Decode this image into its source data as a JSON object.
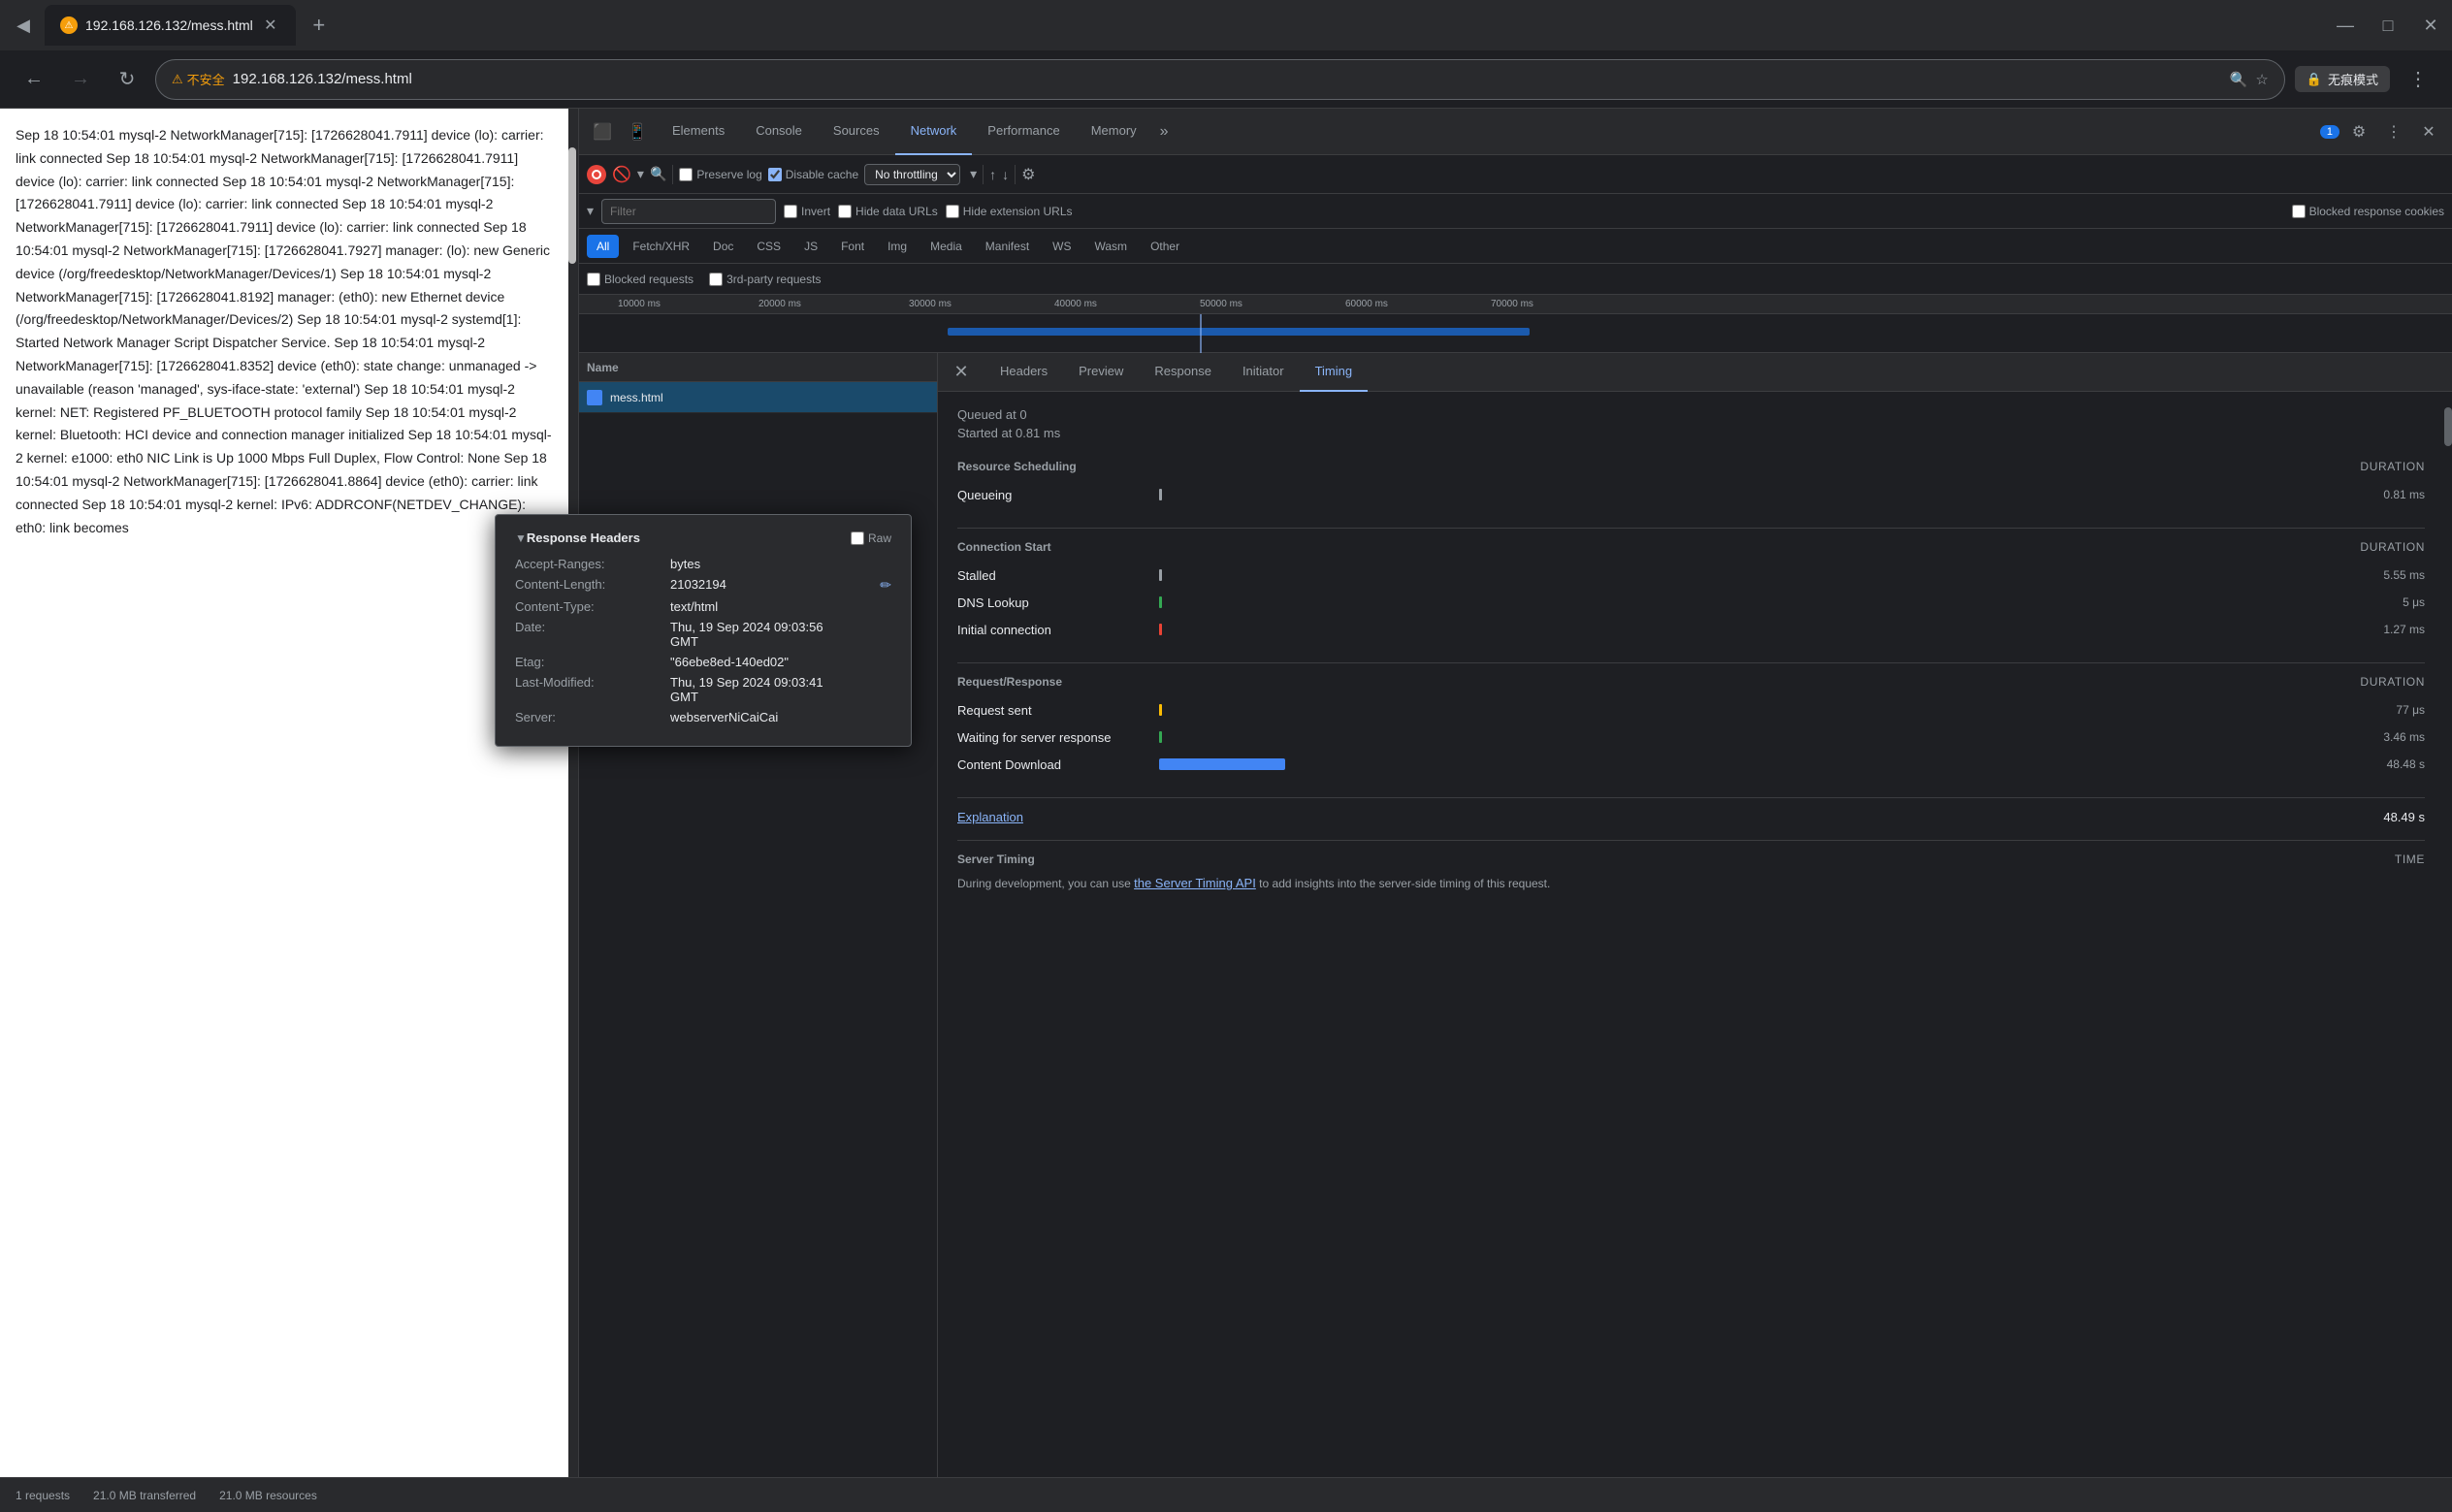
{
  "browser": {
    "tab_url": "192.168.126.132/mess.html",
    "tab_label": "192.168.126.132/mess.html",
    "new_tab_symbol": "+",
    "back_disabled": false,
    "forward_disabled": false,
    "security_warning": "不安全",
    "address": "192.168.126.132/mess.html",
    "private_mode_label": "无痕模式",
    "window_min": "—",
    "window_max": "□",
    "window_close": "✕"
  },
  "page_text": "Sep 18 10:54:01 mysql-2 NetworkManager[715]: [1726628041.7911] device (lo): carrier: link connected Sep 18 10:54:01 mysql-2 NetworkManager[715]: [1726628041.7911] device (lo): carrier: link connected Sep 18 10:54:01 mysql-2 NetworkManager[715]: [1726628041.7911] device (lo): carrier: link connected Sep 18 10:54:01 mysql-2 NetworkManager[715]: [1726628041.7911] device (lo): carrier: link connected Sep 18 10:54:01 mysql-2 NetworkManager[715]: [1726628041.7927] manager: (lo): new Generic device (/org/freedesktop/NetworkManager/Devices/1) Sep 18 10:54:01 mysql-2 NetworkManager[715]: [1726628041.8192] manager: (eth0): new Ethernet device (/org/freedesktop/NetworkManager/Devices/2) Sep 18 10:54:01 mysql-2 systemd[1]: Started Network Manager Script Dispatcher Service. Sep 18 10:54:01 mysql-2 NetworkManager[715]: [1726628041.8352] device (eth0): state change: unmanaged -> unavailable (reason 'managed', sys-iface-state: 'external') Sep 18 10:54:01 mysql-2 kernel: NET: Registered PF_BLUETOOTH protocol family Sep 18 10:54:01 mysql-2 kernel: Bluetooth: HCI device and connection manager initialized Sep 18 10:54:01 mysql-2 kernel: e1000: eth0 NIC Link is Up 1000 Mbps Full Duplex, Flow Control: None Sep 18 10:54:01 mysql-2 NetworkManager[715]: [1726628041.8864] device (eth0): carrier: link connected Sep 18 10:54:01 mysql-2 kernel: IPv6: ADDRCONF(NETDEV_CHANGE): eth0: link becomes",
  "devtools": {
    "tabs": [
      "Elements",
      "Console",
      "Sources",
      "Network",
      "Performance",
      "Memory",
      "»"
    ],
    "active_tab": "Network",
    "badge_count": "1",
    "controls": {
      "preserve_log": "Preserve log",
      "disable_cache": "Disable cache",
      "throttle": "No throttling"
    },
    "filter": {
      "placeholder": "Filter",
      "invert": "Invert",
      "hide_data_urls": "Hide data URLs",
      "hide_extension_urls": "Hide extension URLs",
      "blocked_cookies": "Blocked response cookies"
    },
    "filter_types": [
      "All",
      "Fetch/XHR",
      "Doc",
      "CSS",
      "JS",
      "Font",
      "Img",
      "Media",
      "Manifest",
      "WS",
      "Wasm",
      "Other"
    ],
    "active_filter_type": "All",
    "request_options": {
      "blocked_requests": "Blocked requests",
      "third_party": "3rd-party requests"
    },
    "timeline": {
      "labels": [
        "10000 ms",
        "20000 ms",
        "30000 ms",
        "40000 ms",
        "50000 ms",
        "60000 ms",
        "70000 ms"
      ]
    }
  },
  "network_list": {
    "header": "Name",
    "rows": [
      {
        "name": "mess.html",
        "selected": true
      }
    ]
  },
  "detail_panel": {
    "tabs": [
      "Headers",
      "Preview",
      "Response",
      "Initiator",
      "Timing"
    ],
    "active_tab": "Timing",
    "timing": {
      "queued_at": "Queued at 0",
      "started_at": "Started at 0.81 ms",
      "sections": [
        {
          "title": "Resource Scheduling",
          "duration_label": "DURATION",
          "rows": [
            {
              "label": "Queueing",
              "bar_type": "waiting",
              "value": "0.81 ms"
            }
          ]
        },
        {
          "title": "Connection Start",
          "duration_label": "DURATION",
          "rows": [
            {
              "label": "Stalled",
              "bar_type": "waiting",
              "value": "5.55 ms"
            },
            {
              "label": "DNS Lookup",
              "bar_type": "dns",
              "value": "5 μs"
            },
            {
              "label": "Initial connection",
              "bar_type": "connect",
              "value": "1.27 ms"
            }
          ]
        },
        {
          "title": "Request/Response",
          "duration_label": "DURATION",
          "rows": [
            {
              "label": "Request sent",
              "bar_type": "send",
              "value": "77 μs"
            },
            {
              "label": "Waiting for server response",
              "bar_type": "waiting",
              "value": "3.46 ms"
            },
            {
              "label": "Content Download",
              "bar_type": "recv",
              "value": "48.48 s"
            }
          ]
        }
      ],
      "explanation_label": "Explanation",
      "total_value": "48.49 s",
      "server_timing": {
        "title": "Server Timing",
        "time_label": "TIME",
        "description": "During development, you can use the Server Timing API to add insights into the server-side timing of this request."
      },
      "server_timing_api_link": "the Server Timing API"
    }
  },
  "response_headers": {
    "title": "Response Headers",
    "raw_label": "Raw",
    "rows": [
      {
        "key": "Accept-Ranges:",
        "value": "bytes"
      },
      {
        "key": "Content-Length:",
        "value": "21032194",
        "editable": true
      },
      {
        "key": "Content-Type:",
        "value": "text/html"
      },
      {
        "key": "Date:",
        "value": "Thu, 19 Sep 2024 09:03:56 GMT"
      },
      {
        "key": "Etag:",
        "value": "\"66ebe8ed-140ed02\""
      },
      {
        "key": "Last-Modified:",
        "value": "Thu, 19 Sep 2024 09:03:41 GMT"
      },
      {
        "key": "Server:",
        "value": "webserverNiCaiCai"
      }
    ]
  },
  "status_bar": {
    "requests": "1 requests",
    "transferred": "21.0 MB transferred",
    "resources": "21.0 MB resources"
  },
  "icons": {
    "back": "←",
    "forward": "→",
    "refresh": "↻",
    "search": "🔍",
    "star": "☆",
    "lock": "🔒",
    "settings": "⚙",
    "more": "⋮",
    "record": "⏺",
    "clear": "🚫",
    "filter": "▾",
    "upload": "↑",
    "download": "↓",
    "close": "✕",
    "chevron": "›",
    "triangle_down": "▼",
    "pencil": "✏",
    "more_vert": "⋮"
  }
}
